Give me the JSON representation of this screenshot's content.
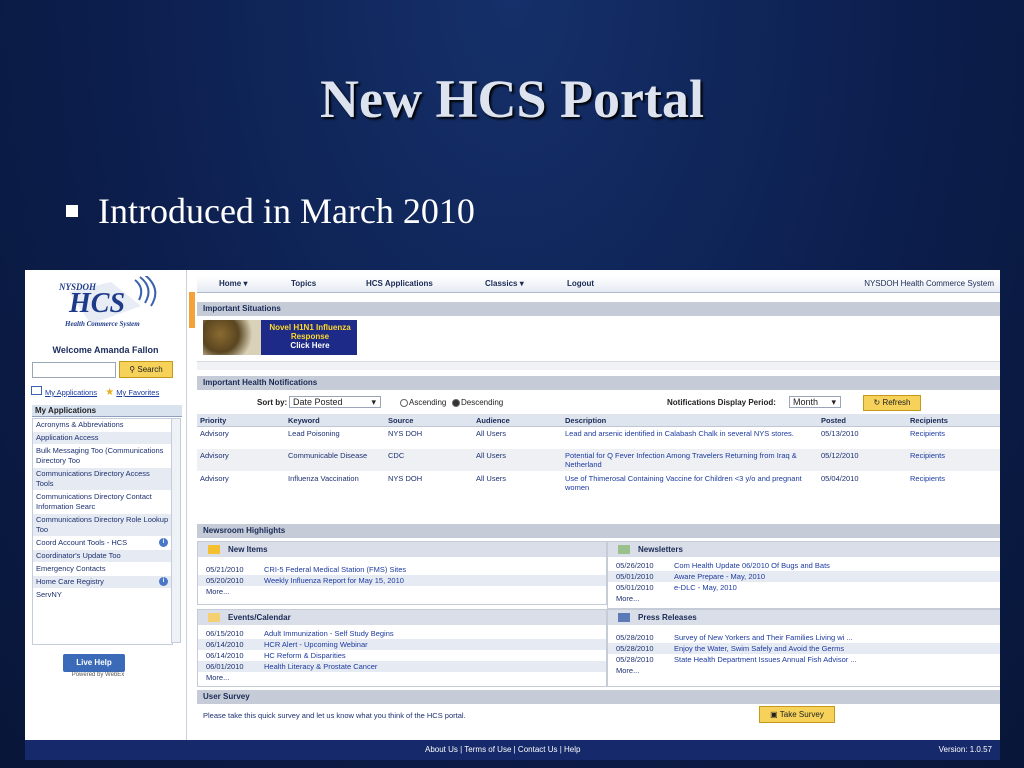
{
  "slide": {
    "title": "New HCS Portal",
    "bullet": "Introduced in March 2010"
  },
  "portal": {
    "logo": {
      "top": "NYSDOH",
      "main": "HCS",
      "sub": "Health Commerce System"
    },
    "welcome": "Welcome Amanda Fallon",
    "search_button": "Search",
    "search_placeholder": "",
    "links": {
      "my_applications": "My Applications",
      "my_favorites": "My Favorites"
    },
    "apps_header": "My Applications",
    "apps": [
      {
        "label": "Acronyms & Abbreviations"
      },
      {
        "label": "Application Access"
      },
      {
        "label": "Bulk Messaging Too (Communications Directory Too"
      },
      {
        "label": "Communications Directory Access Tools"
      },
      {
        "label": "Communications Directory Contact Information Searc"
      },
      {
        "label": "Communications Directory Role Lookup Too"
      },
      {
        "label": "Coord Account Tools - HCS",
        "info": true
      },
      {
        "label": "Coordinator's Update Too"
      },
      {
        "label": "Emergency Contacts"
      },
      {
        "label": "Home Care Registry",
        "info": true
      },
      {
        "label": "ServNY"
      }
    ],
    "live_help": "Live Help",
    "live_help_sub": "Powered by WebEx",
    "nav": {
      "home": "Home",
      "topics": "Topics",
      "hcs_apps": "HCS Applications",
      "classics": "Classics",
      "logout": "Logout",
      "system": "NYSDOH Health Commerce System"
    },
    "important_situations": "Important Situations",
    "banner": {
      "line1": "Novel H1N1 Influenza",
      "line2": "Response",
      "line3": "Click Here"
    },
    "notifications_title": "Important Health Notifications",
    "sort_by_label": "Sort by:",
    "sort_by_value": "Date Posted",
    "ascending": "Ascending",
    "descending": "Descending",
    "period_label": "Notifications Display Period:",
    "period_value": "Month",
    "refresh": "Refresh",
    "table_headers": [
      "Priority",
      "Keyword",
      "Source",
      "Audience",
      "Description",
      "Posted",
      "Recipients"
    ],
    "table_rows": [
      [
        "Advisory",
        "Lead Poisoning",
        "NYS DOH",
        "All Users",
        "Lead and arsenic identified in Calabash Chalk in several NYS stores.",
        "05/13/2010",
        "Recipients"
      ],
      [
        "Advisory",
        "Communicable Disease",
        "CDC",
        "All Users",
        "Potential for Q Fever Infection Among Travelers Returning from Iraq & Netherland",
        "05/12/2010",
        "Recipients"
      ],
      [
        "Advisory",
        "Influenza Vaccination",
        "NYS DOH",
        "All Users",
        "Use of Thimerosal Containing Vaccine for Children <3 y/o and pregnant women",
        "05/04/2010",
        "Recipients"
      ]
    ],
    "newsroom_title": "Newsroom Highlights",
    "new_items": {
      "title": "New Items",
      "rows": [
        {
          "date": "05/21/2010",
          "text": "CRI-5 Federal Medical Station (FMS) Sites"
        },
        {
          "date": "05/20/2010",
          "text": "Weekly Influenza Report for May 15, 2010"
        }
      ],
      "more": "More..."
    },
    "newsletters": {
      "title": "Newsletters",
      "rows": [
        {
          "date": "05/26/2010",
          "text": "Com Health Update 06/2010 Of Bugs and Bats"
        },
        {
          "date": "05/01/2010",
          "text": "Aware Prepare - May, 2010"
        },
        {
          "date": "05/01/2010",
          "text": "e-DLC - May, 2010"
        }
      ],
      "more": "More..."
    },
    "events": {
      "title": "Events/Calendar",
      "rows": [
        {
          "date": "06/15/2010",
          "text": "Adult Immunization - Self Study Begins"
        },
        {
          "date": "06/14/2010",
          "text": "HCR Alert - Upcoming Webinar"
        },
        {
          "date": "06/14/2010",
          "text": "HC Reform & Disparities"
        },
        {
          "date": "06/01/2010",
          "text": "Health Literacy & Prostate Cancer"
        }
      ],
      "more": "More..."
    },
    "press": {
      "title": "Press Releases",
      "rows": [
        {
          "date": "05/28/2010",
          "text": "Survey of New Yorkers and Their Families Living wi ..."
        },
        {
          "date": "05/28/2010",
          "text": "Enjoy the Water, Swim Safely and Avoid the Germs"
        },
        {
          "date": "05/28/2010",
          "text": "State Health Department Issues Annual Fish Advisor ..."
        }
      ],
      "more": "More..."
    },
    "survey_title": "User Survey",
    "survey_text": "Please take this quick survey and let us know what you think of the HCS portal.",
    "survey_button": "Take Survey",
    "footer_links": "About Us | Terms of Use | Contact Us | Help",
    "version": "Version: 1.0.57"
  }
}
